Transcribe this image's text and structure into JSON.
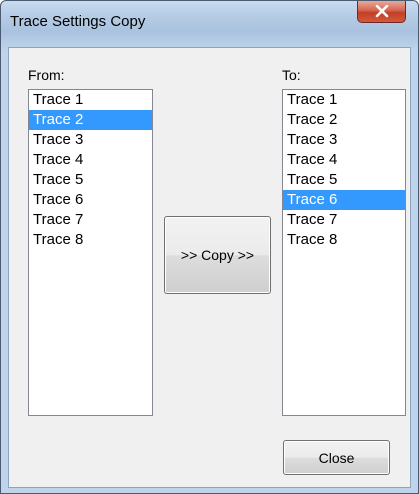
{
  "window": {
    "title": "Trace Settings Copy"
  },
  "from": {
    "label": "From:",
    "items": [
      "Trace 1",
      "Trace 2",
      "Trace 3",
      "Trace 4",
      "Trace 5",
      "Trace 6",
      "Trace 7",
      "Trace 8"
    ],
    "selected": "Trace 2"
  },
  "to": {
    "label": "To:",
    "items": [
      "Trace 1",
      "Trace 2",
      "Trace 3",
      "Trace 4",
      "Trace 5",
      "Trace 6",
      "Trace 7",
      "Trace 8"
    ],
    "selected": "Trace 6"
  },
  "buttons": {
    "copy_label": ">> Copy >>",
    "close_label": "Close"
  },
  "colors": {
    "selection": "#3399ff",
    "close_x": "#c8452c"
  }
}
